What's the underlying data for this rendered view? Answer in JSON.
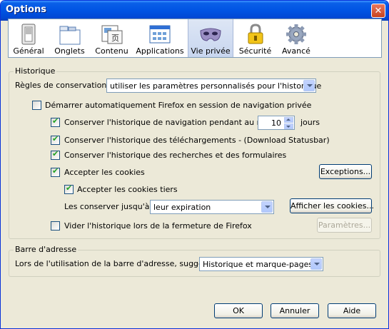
{
  "window": {
    "title": "Options",
    "close_symbol": "✕"
  },
  "toolbar": {
    "items": [
      {
        "label": "Général",
        "icon": "general-switch-icon"
      },
      {
        "label": "Onglets",
        "icon": "tabs-window-icon"
      },
      {
        "label": "Contenu",
        "icon": "content-page-icon"
      },
      {
        "label": "Applications",
        "icon": "applications-window-icon"
      },
      {
        "label": "Vie privée",
        "icon": "privacy-mask-icon",
        "active": true
      },
      {
        "label": "Sécurité",
        "icon": "security-lock-icon"
      },
      {
        "label": "Avancé",
        "icon": "advanced-gear-icon"
      }
    ]
  },
  "history": {
    "legend": "Historique",
    "rules_label": "Règles de conservation :",
    "rules_value": "utiliser les paramètres personnalisés pour l'historique",
    "private_mode_label": "Démarrer automatiquement Firefox en session de navigation privée",
    "private_mode_checked": false,
    "keep_browsing_label": "Conserver l'historique de navigation pendant au moins",
    "keep_browsing_checked": true,
    "keep_days_value": "10",
    "keep_days_unit": "jours",
    "keep_downloads_label": "Conserver l'historique des téléchargements - (Download Statusbar)",
    "keep_downloads_checked": true,
    "keep_forms_label": "Conserver l'historique des recherches et des formulaires",
    "keep_forms_checked": true,
    "accept_cookies_label": "Accepter les cookies",
    "accept_cookies_checked": true,
    "exceptions_button": "Exceptions...",
    "third_party_label": "Accepter les cookies tiers",
    "third_party_checked": true,
    "keep_until_label": "Les conserver jusqu'à :",
    "keep_until_value": "leur expiration",
    "show_cookies_button": "Afficher les cookies...",
    "clear_on_close_label": "Vider l'historique lors de la fermeture de Firefox",
    "clear_on_close_checked": false,
    "settings_button": "Paramètres..."
  },
  "address_bar": {
    "legend": "Barre d'adresse",
    "suggest_label": "Lors de l'utilisation de la barre d'adresse, suggérer :",
    "suggest_value": "Historique et marque-pages"
  },
  "buttons": {
    "ok": "OK",
    "cancel": "Annuler",
    "help": "Aide"
  }
}
